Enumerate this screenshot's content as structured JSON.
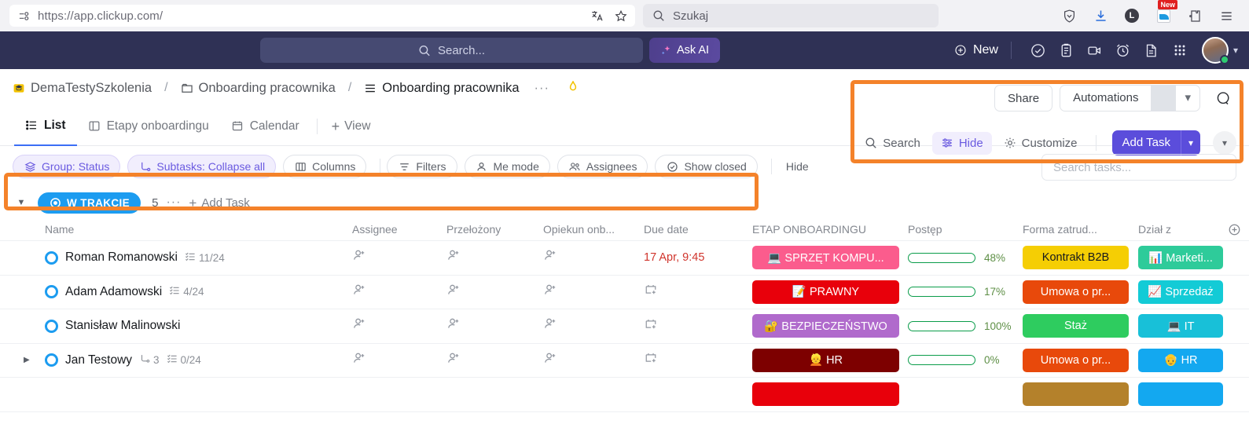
{
  "browser": {
    "url": "https://app.clickup.com/",
    "url_icon": "page-info-icon",
    "translate_icon": "translate-icon",
    "bookmark_icon": "star-icon",
    "search_placeholder": "Szukaj",
    "search_icon": "search-icon",
    "icons": [
      "shield-icon",
      "download-icon",
      "account-icon",
      "extension-new-icon",
      "extensions-icon",
      "menu-icon"
    ],
    "new_badge": "New"
  },
  "app_header": {
    "search_placeholder": "Search...",
    "search_icon": "search-icon",
    "ask_ai_label": "Ask AI",
    "ask_ai_icon": "sparkle-icon",
    "new_label": "New",
    "new_icon": "plus-circle-icon",
    "icons": [
      "check-circle-icon",
      "clipboard-icon",
      "video-camera-icon",
      "alarm-clock-icon",
      "document-icon",
      "apps-grid-icon"
    ],
    "avatar_caret": "chevron-down-icon"
  },
  "breadcrumb": {
    "workspace": "DemaTestySzkolenia",
    "workspace_icon": "graduation-cap-icon",
    "folder": "Onboarding pracownika",
    "folder_icon": "folder-icon",
    "list": "Onboarding pracownika",
    "list_icon": "list-icon",
    "sep": "/",
    "more": "···",
    "flame_icon": "flame-icon"
  },
  "view_tabs": [
    {
      "label": "List",
      "icon": "list-view-icon",
      "active": true
    },
    {
      "label": "Etapy onboardingu",
      "icon": "board-view-icon",
      "active": false
    },
    {
      "label": "Calendar",
      "icon": "calendar-view-icon",
      "active": false
    }
  ],
  "add_view_label": "View",
  "top_right": {
    "share_label": "Share",
    "automations_label": "Automations",
    "automations_caret": "chevron-down-icon",
    "help_icon": "help-search-icon"
  },
  "view_controls": {
    "search_label": "Search",
    "search_icon": "search-icon",
    "hide_label": "Hide",
    "hide_icon": "sliders-icon",
    "customize_label": "Customize",
    "customize_icon": "gear-icon",
    "add_task_label": "Add Task",
    "add_task_caret": "chevron-down-icon",
    "more_caret": "chevron-down-icon"
  },
  "filter_bar": {
    "items": [
      {
        "label": "Group: Status",
        "icon": "layers-icon",
        "selected": true
      },
      {
        "label": "Subtasks: Collapse all",
        "icon": "subtask-icon",
        "selected": true
      },
      {
        "label": "Columns",
        "icon": "columns-icon",
        "selected": false
      },
      {
        "label": "Filters",
        "icon": "filter-icon",
        "selected": false
      },
      {
        "label": "Me mode",
        "icon": "person-icon",
        "selected": false
      },
      {
        "label": "Assignees",
        "icon": "people-icon",
        "selected": false
      },
      {
        "label": "Show closed",
        "icon": "check-circle-icon",
        "selected": false
      },
      {
        "label": "Hide",
        "icon": "",
        "selected": false,
        "plain": true
      }
    ],
    "search_tasks_placeholder": "Search tasks..."
  },
  "group": {
    "caret_icon": "chevron-down-icon",
    "status_label": "W TRAKCIE",
    "status_icon": "status-circle-icon",
    "status_color": "#1c9cf0",
    "count": "5",
    "more": "···",
    "add_task_label": "Add Task"
  },
  "table": {
    "columns": [
      "Name",
      "Assignee",
      "Przełożony",
      "Opiekun onb...",
      "Due date",
      "ETAP ONBOARDINGU",
      "Postęp",
      "Forma zatrud...",
      "Dział z"
    ],
    "add_column_icon": "plus-circle-icon",
    "rows": [
      {
        "name": "Roman Romanowski",
        "checklist": "11/24",
        "checklist_icon": "checklist-icon",
        "subtasks": "",
        "expandable": false,
        "assignee_icon": "add-person-icon",
        "przelozony_icon": "add-person-icon",
        "opiekun_icon": "add-person-icon",
        "due_date": "17 Apr, 9:45",
        "due_overdue": true,
        "etap": "💻 SPRZĘT KOMPU...",
        "etap_color": "#FB5C8D",
        "progress": 48,
        "progress_label": "48%",
        "forma": "Kontrakt B2B",
        "forma_color": "#F5CE04",
        "forma_dark_text": true,
        "dzial": "📊 Marketi...",
        "dzial_color": "#2ecb9a"
      },
      {
        "name": "Adam Adamowski",
        "checklist": "4/24",
        "checklist_icon": "checklist-icon",
        "subtasks": "",
        "expandable": false,
        "assignee_icon": "add-person-icon",
        "przelozony_icon": "add-person-icon",
        "opiekun_icon": "add-person-icon",
        "due_date": "",
        "due_overdue": false,
        "etap": "📝 PRAWNY",
        "etap_color": "#E8000B",
        "progress": 17,
        "progress_label": "17%",
        "forma": "Umowa o pr...",
        "forma_color": "#E8490B",
        "forma_dark_text": false,
        "dzial": "📈 Sprzedaż",
        "dzial_color": "#13CBD6"
      },
      {
        "name": "Stanisław Malinowski",
        "checklist": "",
        "checklist_icon": "",
        "subtasks": "",
        "expandable": false,
        "assignee_icon": "add-person-icon",
        "przelozony_icon": "add-person-icon",
        "opiekun_icon": "add-person-icon",
        "due_date": "",
        "due_overdue": false,
        "etap": "🔐 BEZPIECZEŃSTWO",
        "etap_color": "#B06ACC",
        "progress": 100,
        "progress_label": "100%",
        "forma": "Staż",
        "forma_color": "#2ECC5F",
        "forma_dark_text": false,
        "dzial": "💻 IT",
        "dzial_color": "#18C0D8"
      },
      {
        "name": "Jan Testowy",
        "checklist": "0/24",
        "checklist_icon": "checklist-icon",
        "subtasks": "3",
        "subtask_icon": "subtask-icon",
        "expandable": true,
        "assignee_icon": "add-person-icon",
        "przelozony_icon": "add-person-icon",
        "opiekun_icon": "add-person-icon",
        "due_date": "",
        "due_overdue": false,
        "etap": "👱 HR",
        "etap_color": "#7D0000",
        "progress": 0,
        "progress_label": "0%",
        "forma": "Umowa o pr...",
        "forma_color": "#E8490B",
        "forma_dark_text": false,
        "dzial": "👴 HR",
        "dzial_color": "#13A8F0"
      },
      {
        "name": "",
        "checklist": "",
        "checklist_icon": "",
        "subtasks": "",
        "expandable": false,
        "assignee_icon": "",
        "przelozony_icon": "",
        "opiekun_icon": "",
        "due_date": "",
        "due_overdue": false,
        "etap": "",
        "etap_color": "#E8000B",
        "progress": 0,
        "progress_label": "",
        "forma": "",
        "forma_color": "#B4812B",
        "forma_dark_text": false,
        "dzial": "",
        "dzial_color": "#13A8F0"
      }
    ]
  },
  "annotations": {
    "color": "#F4822A"
  }
}
